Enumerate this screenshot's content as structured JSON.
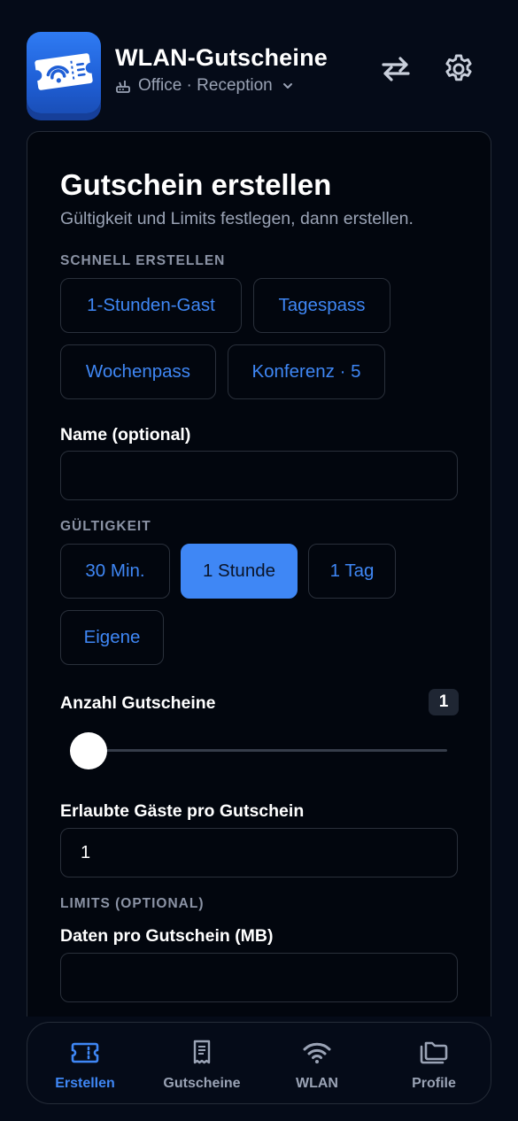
{
  "header": {
    "app_title": "WLAN-Gutscheine",
    "site_label": "Office · Reception",
    "icons": [
      "ticket-wifi-icon",
      "router-icon",
      "chevron-down-icon",
      "swap-icon",
      "gear-icon"
    ]
  },
  "card": {
    "title": "Gutschein erstellen",
    "subtitle": "Gültigkeit und Limits festlegen, dann erstellen.",
    "quick_create": {
      "label": "SCHNELL ERSTELLEN",
      "presets": [
        "1-Stunden-Gast",
        "Tagespass",
        "Wochenpass",
        "Konferenz · 5"
      ]
    },
    "name_field": {
      "label": "Name (optional)",
      "value": ""
    },
    "validity": {
      "label": "GÜLTIGKEIT",
      "options": [
        "30 Min.",
        "1 Stunde",
        "1 Tag",
        "Eigene"
      ],
      "selected": "1 Stunde"
    },
    "voucher_count": {
      "label": "Anzahl Gutscheine",
      "value": "1"
    },
    "guests_per_voucher": {
      "label": "Erlaubte Gäste pro Gutschein",
      "value": "1"
    },
    "limits": {
      "label": "LIMITS (OPTIONAL)",
      "data_label": "Daten pro Gutschein (MB)",
      "data_value": ""
    }
  },
  "nav": {
    "items": [
      {
        "label": "Erstellen",
        "icon": "ticket-icon",
        "active": true
      },
      {
        "label": "Gutscheine",
        "icon": "receipt-icon",
        "active": false
      },
      {
        "label": "WLAN",
        "icon": "wifi-icon",
        "active": false
      },
      {
        "label": "Profile",
        "icon": "folders-icon",
        "active": false
      }
    ]
  },
  "colors": {
    "background": "#050b18",
    "accent": "#3f87f5",
    "muted_text": "#9aa3b5",
    "border": "#2a303b"
  }
}
